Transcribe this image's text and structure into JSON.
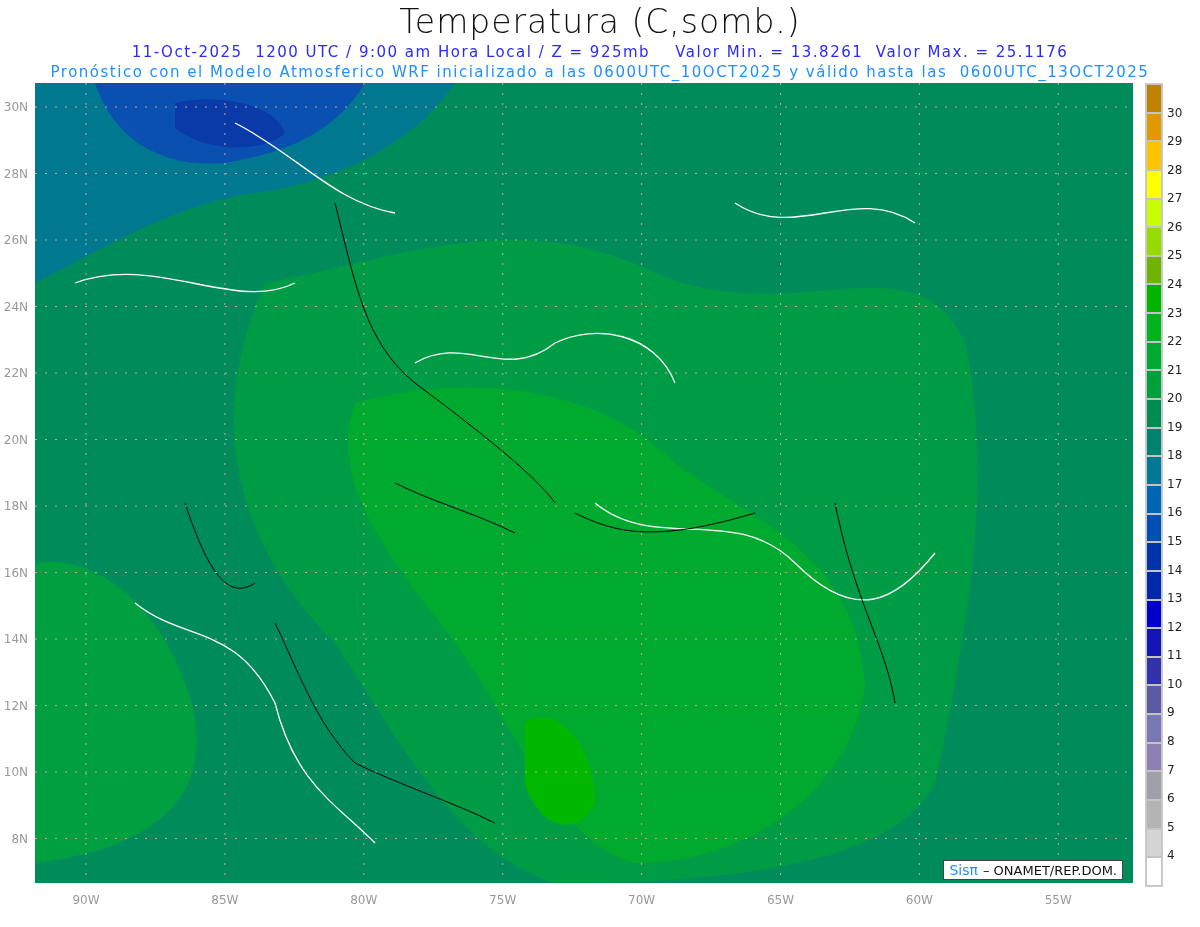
{
  "title": "Temperatura (C,somb.)",
  "subtitle_lines": [
    "11-Oct-2025  1200 UTC / 9:00 am Hora Local / Z = 925mb    Valor Min. = 13.8261  Valor Max. = 25.1176",
    "Pronóstico con el Modelo Atmosferico WRF inicializado a las 0600UTC_10OCT2025 y válido hasta las  0600UTC_13OCT2025"
  ],
  "map": {
    "kind": "picture",
    "credit": {
      "brand": "Sisπ",
      "text": "– ONAMET/REP.DOM."
    }
  },
  "y_ticks": [
    "30N",
    "28N",
    "26N",
    "24N",
    "22N",
    "20N",
    "18N",
    "16N",
    "14N",
    "12N",
    "10N",
    "8N"
  ],
  "x_ticks": [
    "90W",
    "85W",
    "80W",
    "75W",
    "70W",
    "65W",
    "60W",
    "55W"
  ],
  "colorbar": {
    "bins": [
      {
        "color": "#c08000"
      },
      {
        "color": "#e09a00"
      },
      {
        "color": "#ffc400"
      },
      {
        "color": "#ffff00"
      },
      {
        "color": "#c8ff00"
      },
      {
        "color": "#96dc00"
      },
      {
        "color": "#6eb400"
      },
      {
        "color": "#00b400"
      },
      {
        "color": "#00b41e"
      },
      {
        "color": "#00aa32"
      },
      {
        "color": "#00a03c"
      },
      {
        "color": "#008c50"
      },
      {
        "color": "#00826e"
      },
      {
        "color": "#007896"
      },
      {
        "color": "#0064b4"
      },
      {
        "color": "#0050b4"
      },
      {
        "color": "#0032aa"
      },
      {
        "color": "#0028aa"
      },
      {
        "color": "#0000c8"
      },
      {
        "color": "#1414b4"
      },
      {
        "color": "#3232aa"
      },
      {
        "color": "#5a5aa5"
      },
      {
        "color": "#7878b4"
      },
      {
        "color": "#8c80b4"
      },
      {
        "color": "#a0a0aa"
      },
      {
        "color": "#b4b4b4"
      },
      {
        "color": "#d4d4d4"
      },
      {
        "color": "#ffffff"
      }
    ],
    "labels": [
      "30",
      "29",
      "28",
      "27",
      "26",
      "25",
      "24",
      "23",
      "22",
      "21",
      "20",
      "19",
      "18",
      "17",
      "16",
      "15",
      "14",
      "13",
      "12",
      "11",
      "10",
      "9",
      "8",
      "7",
      "6",
      "5",
      "4"
    ]
  }
}
